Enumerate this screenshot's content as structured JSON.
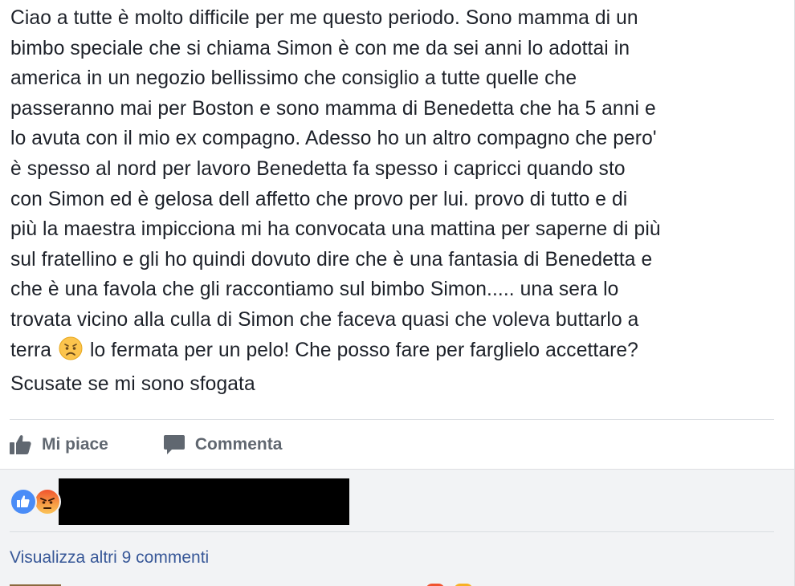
{
  "post": {
    "lines": [
      "Ciao a tutte è molto difficile per me questo periodo. Sono mamma di un",
      "bimbo speciale che si chiama Simon è con me da sei anni lo adottai in",
      "america in un negozio bellissimo che consiglio a tutte quelle che",
      "passeranno mai per Boston e sono mamma di Benedetta che ha 5 anni e",
      "lo avuta con il mio ex compagno. Adesso ho un altro compagno che pero'",
      "è spesso al nord per lavoro Benedetta fa spesso i capricci quando sto",
      "con Simon ed è gelosa dell affetto che provo per lui. provo di tutto e di",
      "più la maestra impicciona mi ha convocata una mattina per saperne di più",
      "sul fratellino e gli ho quindi dovuto dire che è una fantasia di Benedetta e",
      "che è una favola che gli raccontiamo sul bimbo Simon..... una sera lo",
      "trovata vicino alla culla di Simon che faceva quasi che voleva buttarlo a"
    ],
    "line12_before": "terra",
    "line12_emoji": "worried-face-emoji",
    "line12_after": "lo fermata per un pelo! Che posso fare per farglielo accettare?",
    "line13": "Scusate se mi sono sfogata"
  },
  "actions": {
    "like_label": "Mi piace",
    "like_icon": "thumbs-up-icon",
    "comment_label": "Commenta",
    "comment_icon": "speech-bubble-icon"
  },
  "reactions": {
    "icons": [
      "like-reaction-icon",
      "angry-reaction-icon"
    ],
    "colors": {
      "like": "#4a8cf7",
      "angry": "#f0532e"
    }
  },
  "comments": {
    "view_more_label": "Visualizza altri 9 commenti",
    "link_color": "#385898"
  },
  "colors": {
    "text": "#1d2129",
    "action_text": "#606770",
    "comments_bg": "#f2f3f5"
  }
}
